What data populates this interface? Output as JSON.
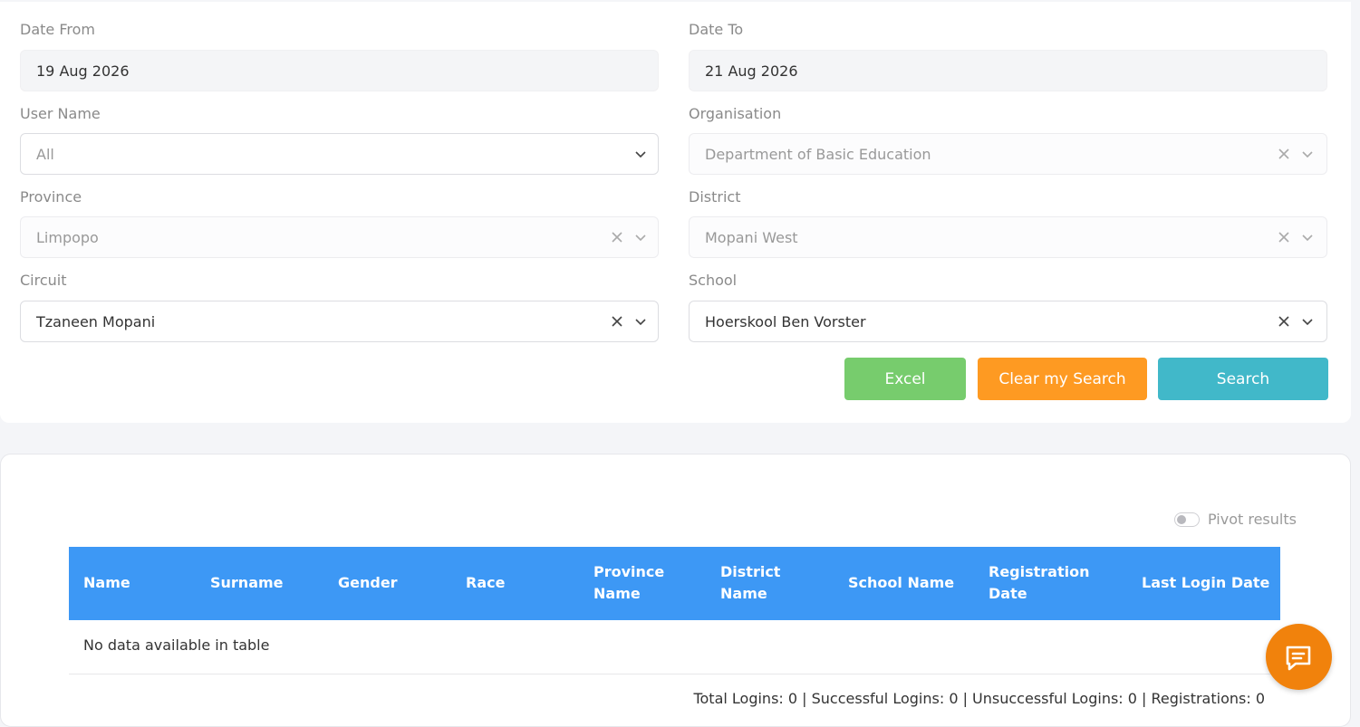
{
  "filters": {
    "date_from": {
      "label": "Date From",
      "value": "19 Aug 2026"
    },
    "date_to": {
      "label": "Date To",
      "value": "21 Aug 2026"
    },
    "user_name": {
      "label": "User Name",
      "value": "All"
    },
    "organisation": {
      "label": "Organisation",
      "value": "Department of Basic Education"
    },
    "province": {
      "label": "Province",
      "value": "Limpopo"
    },
    "district": {
      "label": "District",
      "value": "Mopani West"
    },
    "circuit": {
      "label": "Circuit",
      "value": "Tzaneen Mopani"
    },
    "school": {
      "label": "School",
      "value": "Hoerskool Ben Vorster"
    }
  },
  "buttons": {
    "excel": "Excel",
    "clear": "Clear my Search",
    "search": "Search"
  },
  "colors": {
    "excel": "#77cc6d",
    "clear": "#fe9a22",
    "search": "#41b8c9",
    "table_header": "#3d98f5",
    "chat": "#f1820c"
  },
  "results": {
    "pivot_label": "Pivot results",
    "pivot_on": false,
    "columns": [
      "Name",
      "Surname",
      "Gender",
      "Race",
      "Province Name",
      "District Name",
      "School Name",
      "Registration Date",
      "Last Login Date"
    ],
    "empty_message": "No data available in table",
    "summary": "Total Logins: 0 | Successful Logins: 0 | Unsuccessful Logins: 0 | Registrations: 0"
  },
  "icons": {
    "clear": "close-icon",
    "dropdown": "chevron-down-icon",
    "chat": "chat-icon"
  }
}
